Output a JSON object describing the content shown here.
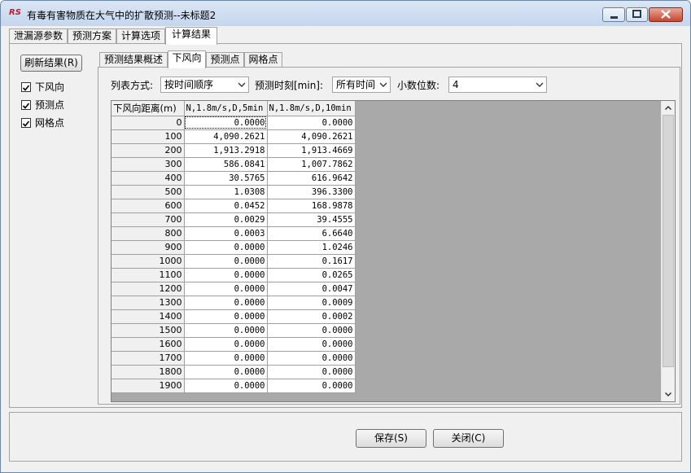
{
  "window": {
    "title": "有毒有害物质在大气中的扩散预测--未标题2",
    "app_icon_text": "RS"
  },
  "top_tabs": [
    "泄漏源参数",
    "预测方案",
    "计算选项",
    "计算结果"
  ],
  "left": {
    "refresh_label": "刷新结果(R)",
    "checks": [
      {
        "label": "下风向",
        "checked": true
      },
      {
        "label": "预测点",
        "checked": true
      },
      {
        "label": "网格点",
        "checked": true
      }
    ]
  },
  "inner_tabs": [
    "预测结果概述",
    "下风向",
    "预测点",
    "网格点"
  ],
  "controls": {
    "list_mode_label": "列表方式:",
    "list_mode_value": "按时间顺序",
    "time_label": "预测时刻[min]:",
    "time_value": "所有时间",
    "decimals_label": "小数位数:",
    "decimals_value": "4"
  },
  "table": {
    "headers": [
      "下风向距离(m)",
      "N,1.8m/s,D,5min",
      "N,1.8m/s,D,10min"
    ],
    "rows": [
      [
        "0",
        "0.0000",
        "0.0000"
      ],
      [
        "100",
        "4,090.2621",
        "4,090.2621"
      ],
      [
        "200",
        "1,913.2918",
        "1,913.4669"
      ],
      [
        "300",
        "586.0841",
        "1,007.7862"
      ],
      [
        "400",
        "30.5765",
        "616.9642"
      ],
      [
        "500",
        "1.0308",
        "396.3300"
      ],
      [
        "600",
        "0.0452",
        "168.9878"
      ],
      [
        "700",
        "0.0029",
        "39.4555"
      ],
      [
        "800",
        "0.0003",
        "6.6640"
      ],
      [
        "900",
        "0.0000",
        "1.0246"
      ],
      [
        "1000",
        "0.0000",
        "0.1617"
      ],
      [
        "1100",
        "0.0000",
        "0.0265"
      ],
      [
        "1200",
        "0.0000",
        "0.0047"
      ],
      [
        "1300",
        "0.0000",
        "0.0009"
      ],
      [
        "1400",
        "0.0000",
        "0.0002"
      ],
      [
        "1500",
        "0.0000",
        "0.0000"
      ],
      [
        "1600",
        "0.0000",
        "0.0000"
      ],
      [
        "1700",
        "0.0000",
        "0.0000"
      ],
      [
        "1800",
        "0.0000",
        "0.0000"
      ],
      [
        "1900",
        "0.0000",
        "0.0000"
      ]
    ]
  },
  "buttons": {
    "save": "保存(S)",
    "close": "关闭(C)"
  }
}
